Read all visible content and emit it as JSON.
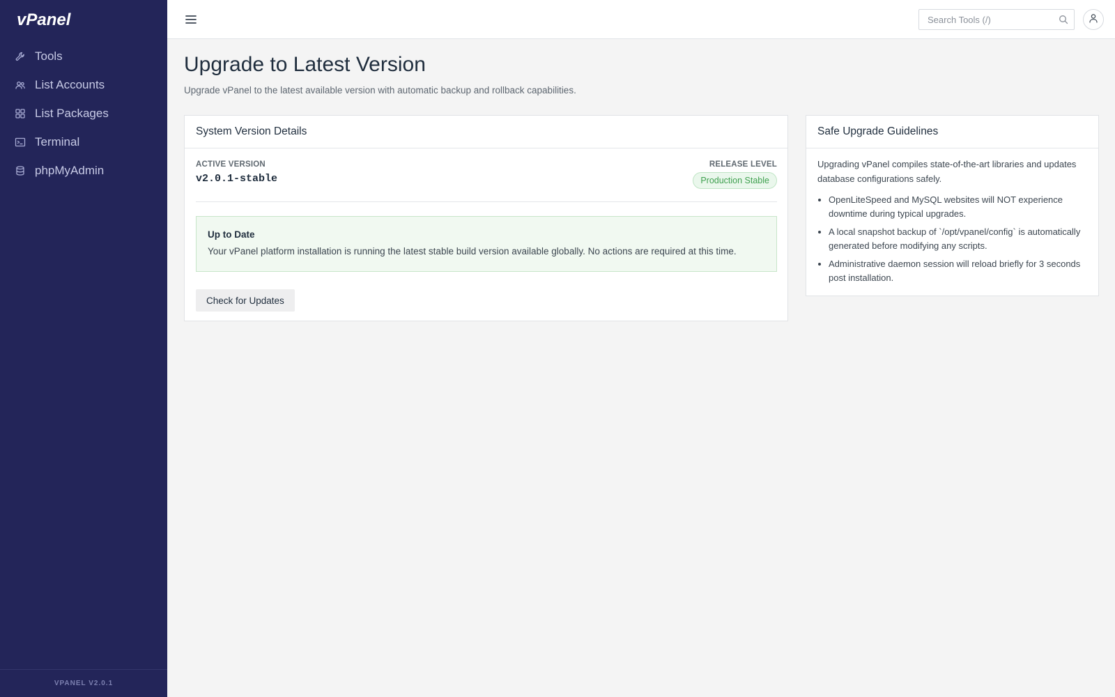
{
  "app": {
    "logo_text": "vPanel",
    "footer_version": "VPANEL V2.0.1"
  },
  "sidebar": {
    "items": [
      {
        "label": "Tools",
        "icon": "wrench-icon"
      },
      {
        "label": "List Accounts",
        "icon": "users-icon"
      },
      {
        "label": "List Packages",
        "icon": "grid-icon"
      },
      {
        "label": "Terminal",
        "icon": "terminal-icon"
      },
      {
        "label": "phpMyAdmin",
        "icon": "database-icon"
      }
    ]
  },
  "topbar": {
    "search_placeholder": "Search Tools (/)",
    "search_icon": "search-icon",
    "user_icon": "user-icon",
    "menu_icon": "hamburger-icon"
  },
  "page": {
    "title": "Upgrade to Latest Version",
    "subtitle": "Upgrade vPanel to the latest available version with automatic backup and rollback capabilities."
  },
  "version_card": {
    "header": "System Version Details",
    "active_version_label": "ACTIVE VERSION",
    "active_version_value": "v2.0.1-stable",
    "release_level_label": "RELEASE LEVEL",
    "release_level_value": "Production Stable",
    "alert_title": "Up to Date",
    "alert_body": "Your vPanel platform installation is running the latest stable build version available globally. No actions are required at this time.",
    "button_label": "Check for Updates"
  },
  "guide_card": {
    "header": "Safe Upgrade Guidelines",
    "intro": "Upgrading vPanel compiles state-of-the-art libraries and updates database configurations safely.",
    "items": [
      "OpenLiteSpeed and MySQL websites will NOT experience downtime during typical upgrades.",
      "A local snapshot backup of `/opt/vpanel/config` is automatically generated before modifying any scripts.",
      "Administrative daemon session will reload briefly for 3 seconds post installation."
    ]
  },
  "colors": {
    "sidebar_bg": "#232559",
    "sidebar_text": "#c8cbe6",
    "badge_green": "#3fa04f",
    "alert_bg": "#f1f9f1"
  }
}
